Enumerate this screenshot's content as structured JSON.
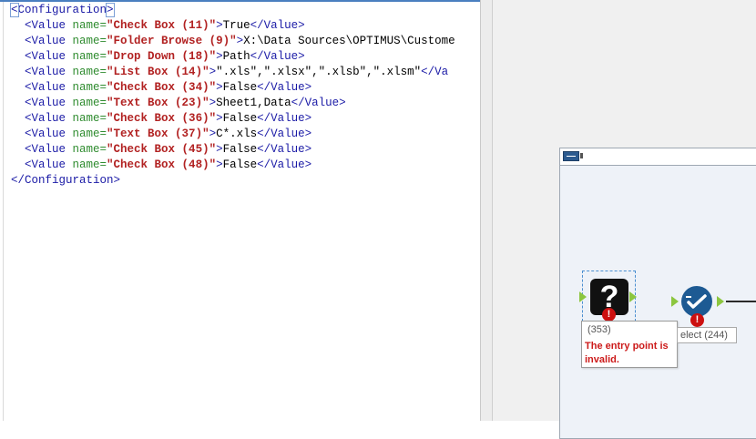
{
  "xml_editor": {
    "lines": [
      [
        {
          "t": "tag-box",
          "v": "<"
        },
        {
          "t": "tag",
          "v": "Configuration"
        },
        {
          "t": "tag-box",
          "v": ">"
        }
      ],
      [
        {
          "t": "txt",
          "v": "  "
        },
        {
          "t": "tag",
          "v": "<Value "
        },
        {
          "t": "attr",
          "v": "name="
        },
        {
          "t": "str",
          "v": "\"Check Box (11)\""
        },
        {
          "t": "tag",
          "v": ">"
        },
        {
          "t": "txt",
          "v": "True"
        },
        {
          "t": "tag",
          "v": "</Value>"
        }
      ],
      [
        {
          "t": "txt",
          "v": "  "
        },
        {
          "t": "tag",
          "v": "<Value "
        },
        {
          "t": "attr",
          "v": "name="
        },
        {
          "t": "str",
          "v": "\"Folder Browse (9)\""
        },
        {
          "t": "tag",
          "v": ">"
        },
        {
          "t": "txt",
          "v": "X:\\Data Sources\\OPTIMUS\\Custome"
        }
      ],
      [
        {
          "t": "txt",
          "v": "  "
        },
        {
          "t": "tag",
          "v": "<Value "
        },
        {
          "t": "attr",
          "v": "name="
        },
        {
          "t": "str",
          "v": "\"Drop Down (18)\""
        },
        {
          "t": "tag",
          "v": ">"
        },
        {
          "t": "txt",
          "v": "Path"
        },
        {
          "t": "tag",
          "v": "</Value>"
        }
      ],
      [
        {
          "t": "txt",
          "v": "  "
        },
        {
          "t": "tag",
          "v": "<Value "
        },
        {
          "t": "attr",
          "v": "name="
        },
        {
          "t": "str",
          "v": "\"List Box (14)\""
        },
        {
          "t": "tag",
          "v": ">"
        },
        {
          "t": "txt",
          "v": "\".xls\",\".xlsx\",\".xlsb\",\".xlsm\""
        },
        {
          "t": "tag",
          "v": "</Va"
        }
      ],
      [
        {
          "t": "txt",
          "v": "  "
        },
        {
          "t": "tag",
          "v": "<Value "
        },
        {
          "t": "attr",
          "v": "name="
        },
        {
          "t": "str",
          "v": "\"Check Box (34)\""
        },
        {
          "t": "tag",
          "v": ">"
        },
        {
          "t": "txt",
          "v": "False"
        },
        {
          "t": "tag",
          "v": "</Value>"
        }
      ],
      [
        {
          "t": "txt",
          "v": "  "
        },
        {
          "t": "tag",
          "v": "<Value "
        },
        {
          "t": "attr",
          "v": "name="
        },
        {
          "t": "str",
          "v": "\"Text Box (23)\""
        },
        {
          "t": "tag",
          "v": ">"
        },
        {
          "t": "txt",
          "v": "Sheet1,Data"
        },
        {
          "t": "tag",
          "v": "</Value>"
        }
      ],
      [
        {
          "t": "txt",
          "v": "  "
        },
        {
          "t": "tag",
          "v": "<Value "
        },
        {
          "t": "attr",
          "v": "name="
        },
        {
          "t": "str",
          "v": "\"Check Box (36)\""
        },
        {
          "t": "tag",
          "v": ">"
        },
        {
          "t": "txt",
          "v": "False"
        },
        {
          "t": "tag",
          "v": "</Value>"
        }
      ],
      [
        {
          "t": "txt",
          "v": "  "
        },
        {
          "t": "tag",
          "v": "<Value "
        },
        {
          "t": "attr",
          "v": "name="
        },
        {
          "t": "str",
          "v": "\"Text Box (37)\""
        },
        {
          "t": "tag",
          "v": ">"
        },
        {
          "t": "txt",
          "v": "C*.xls"
        },
        {
          "t": "tag",
          "v": "</Value>"
        }
      ],
      [
        {
          "t": "txt",
          "v": "  "
        },
        {
          "t": "tag",
          "v": "<Value "
        },
        {
          "t": "attr",
          "v": "name="
        },
        {
          "t": "str",
          "v": "\"Check Box (45)\""
        },
        {
          "t": "tag",
          "v": ">"
        },
        {
          "t": "txt",
          "v": "False"
        },
        {
          "t": "tag",
          "v": "</Value>"
        }
      ],
      [
        {
          "t": "txt",
          "v": "  "
        },
        {
          "t": "tag",
          "v": "<Value "
        },
        {
          "t": "attr",
          "v": "name="
        },
        {
          "t": "str",
          "v": "\"Check Box (48)\""
        },
        {
          "t": "tag",
          "v": ">"
        },
        {
          "t": "txt",
          "v": "False"
        },
        {
          "t": "tag",
          "v": "</Value>"
        }
      ],
      [
        {
          "t": "tag",
          "v": "</Configuration>"
        }
      ]
    ]
  },
  "canvas": {
    "tool_353": {
      "icon_glyph": "?",
      "error_glyph": "!",
      "tooltip_id": "(353)",
      "tooltip_message": "The entry point is invalid."
    },
    "tool_244": {
      "label": "elect (244)",
      "error_glyph": "!"
    }
  },
  "colors": {
    "xml_tag": "#1a1aa6",
    "xml_attr": "#2e8b2e",
    "xml_string": "#b22222",
    "error_red": "#cc1010",
    "anchor_green": "#8cc63f",
    "select_tool_blue": "#1d5a93"
  },
  "icons": {
    "tool_353_icon": "question-mark-icon",
    "tool_244_icon": "select-check-icon",
    "error_badge": "error-icon"
  }
}
